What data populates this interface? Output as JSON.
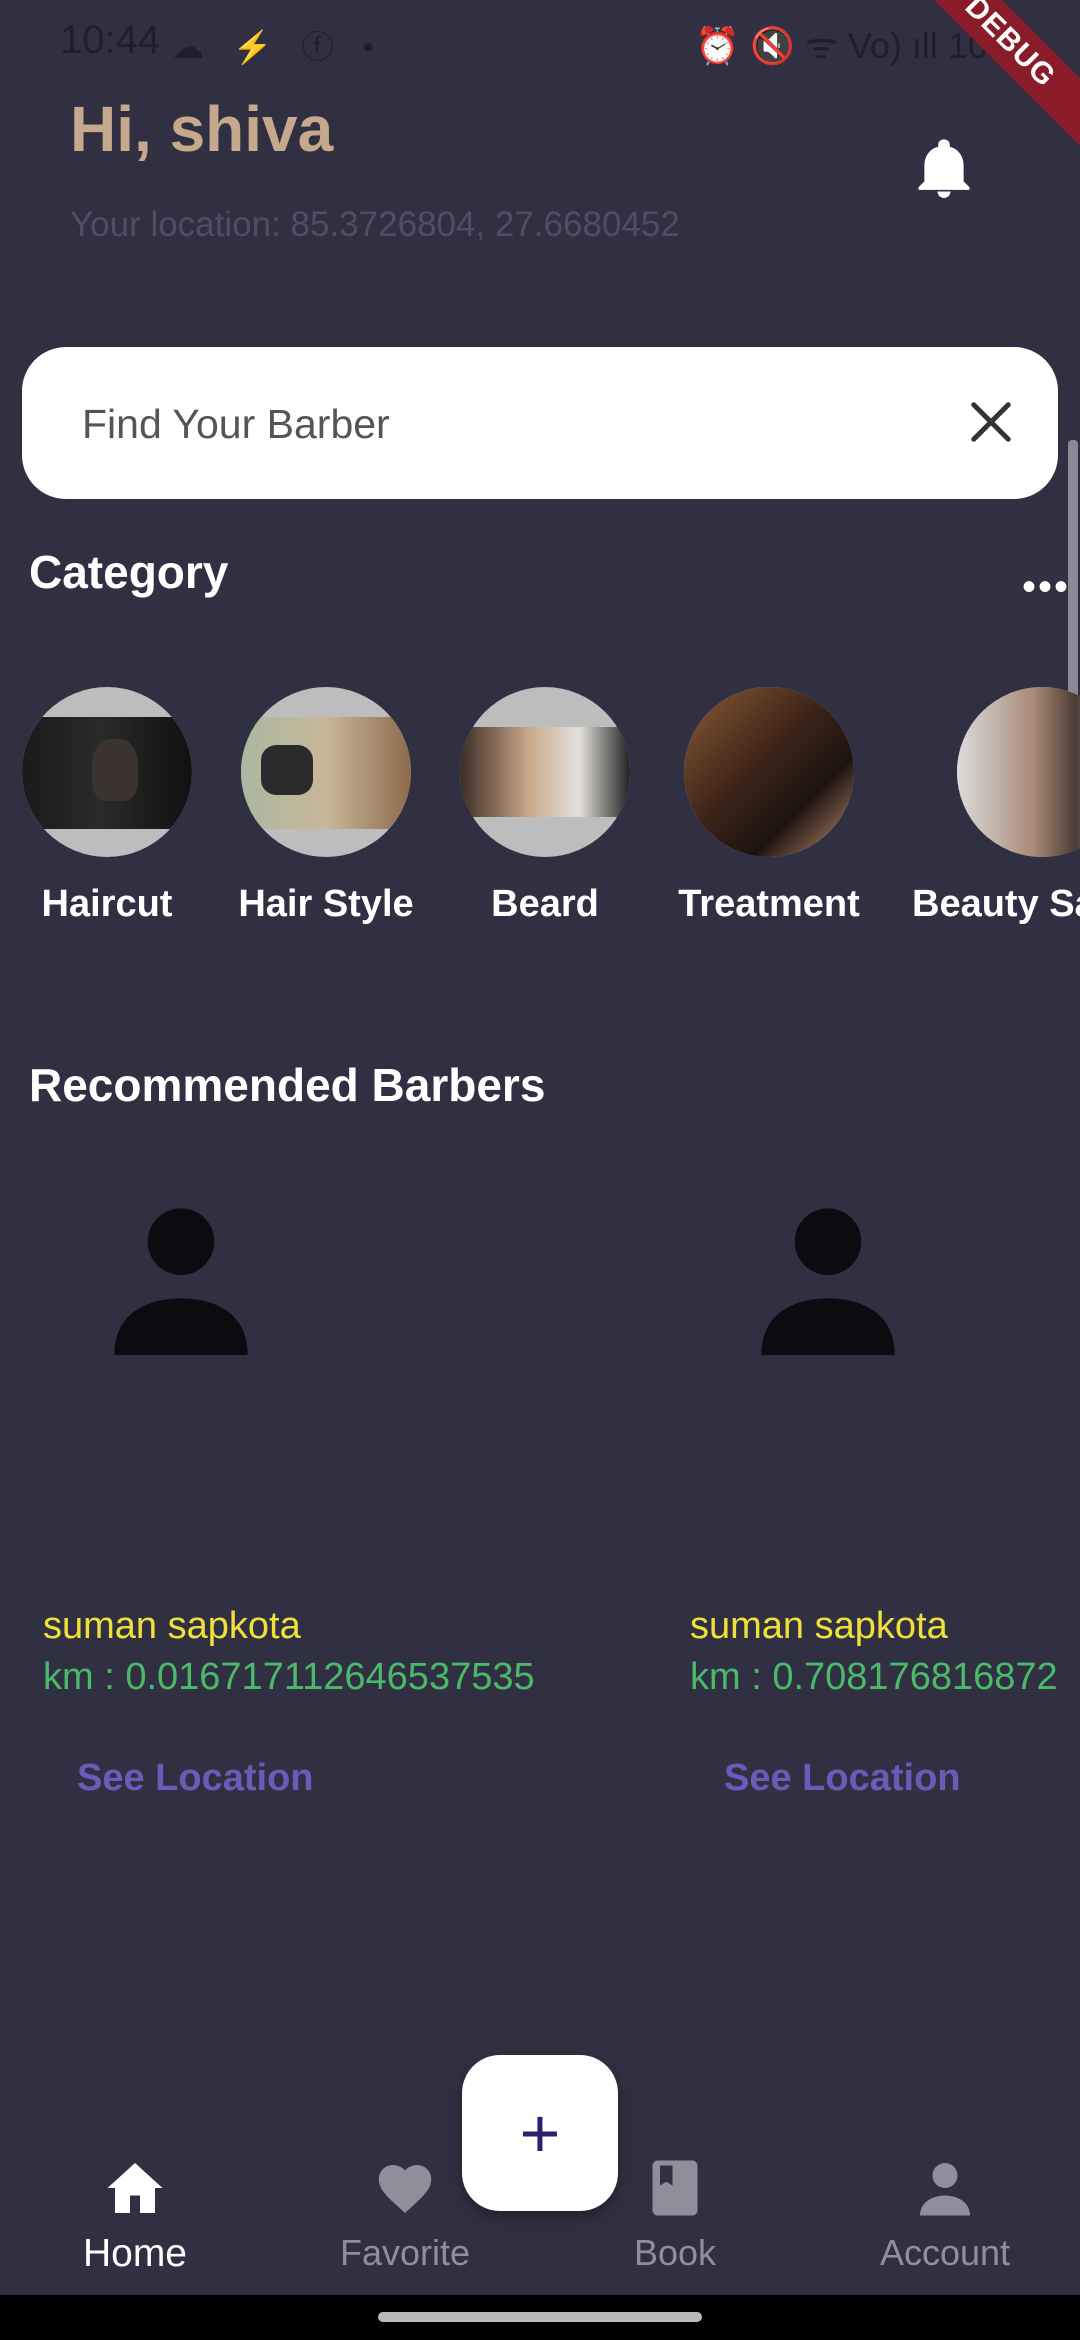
{
  "status_bar": {
    "time": "10:44",
    "left_icons": "☁ ⚡ ⓕ •",
    "right_text": "⏰ 🔇 ᯤ Vo) ıll 100%",
    "debug_label": "DEBUG"
  },
  "header": {
    "greeting": "Hi, shiva",
    "location": "Your location: 85.3726804, 27.6680452"
  },
  "search": {
    "placeholder": "Find Your Barber"
  },
  "category": {
    "title": "Category",
    "more": "•••",
    "items": [
      {
        "label": "Haircut"
      },
      {
        "label": "Hair Style"
      },
      {
        "label": "Beard"
      },
      {
        "label": "Treatment"
      },
      {
        "label": "Beauty Sa"
      }
    ]
  },
  "recommended": {
    "title": "Recommended Barbers",
    "barbers": [
      {
        "name": "suman sapkota",
        "km": "km : 0.016717112646537535",
        "action": "See Location"
      },
      {
        "name": "suman sapkota",
        "km": "km : 0.708176816872",
        "action": "See Location"
      }
    ]
  },
  "fab": {
    "label": "+"
  },
  "nav": {
    "items": [
      {
        "label": "Home",
        "icon": "home-icon",
        "active": true
      },
      {
        "label": "Favorite",
        "icon": "heart-icon",
        "active": false
      },
      {
        "label": "Book",
        "icon": "book-icon",
        "active": false
      },
      {
        "label": "Account",
        "icon": "person-icon",
        "active": false
      }
    ]
  },
  "colors": {
    "background": "#313042",
    "greeting": "#c6a98c",
    "barber_name": "#f0e13a",
    "distance": "#4aba6a",
    "link": "#6a5bb8"
  }
}
